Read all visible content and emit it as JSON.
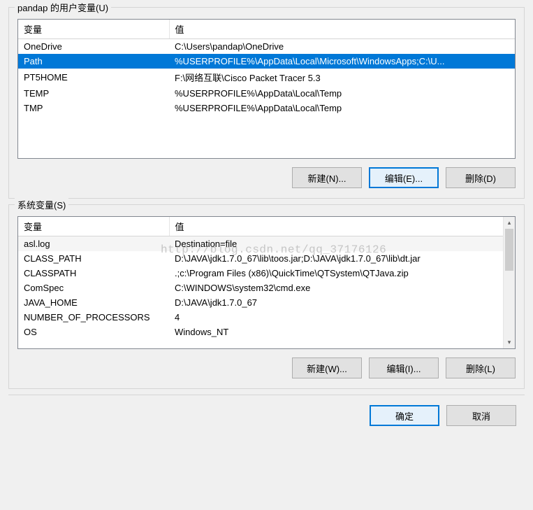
{
  "watermark": "http://blog.csdn.net/qq_37176126",
  "user_section_label": "pandap 的用户变量(U)",
  "system_section_label": "系统变量(S)",
  "col_var": "变量",
  "col_val": "值",
  "user_vars": [
    {
      "name": "OneDrive",
      "value": "C:\\Users\\pandap\\OneDrive"
    },
    {
      "name": "Path",
      "value": "%USERPROFILE%\\AppData\\Local\\Microsoft\\WindowsApps;C:\\U..."
    },
    {
      "name": "PT5HOME",
      "value": "F:\\网络互联\\Cisco Packet Tracer 5.3"
    },
    {
      "name": "TEMP",
      "value": "%USERPROFILE%\\AppData\\Local\\Temp"
    },
    {
      "name": "TMP",
      "value": "%USERPROFILE%\\AppData\\Local\\Temp"
    }
  ],
  "system_vars": [
    {
      "name": "asl.log",
      "value": "Destination=file"
    },
    {
      "name": "CLASS_PATH",
      "value": "D:\\JAVA\\jdk1.7.0_67\\lib\\toos.jar;D:\\JAVA\\jdk1.7.0_67\\lib\\dt.jar"
    },
    {
      "name": "CLASSPATH",
      "value": ".;c:\\Program Files (x86)\\QuickTime\\QTSystem\\QTJava.zip"
    },
    {
      "name": "ComSpec",
      "value": "C:\\WINDOWS\\system32\\cmd.exe"
    },
    {
      "name": "JAVA_HOME",
      "value": "D:\\JAVA\\jdk1.7.0_67"
    },
    {
      "name": "NUMBER_OF_PROCESSORS",
      "value": "4"
    },
    {
      "name": "OS",
      "value": "Windows_NT"
    }
  ],
  "buttons": {
    "user_new": "新建(N)...",
    "user_edit": "编辑(E)...",
    "user_delete": "删除(D)",
    "sys_new": "新建(W)...",
    "sys_edit": "编辑(I)...",
    "sys_delete": "删除(L)",
    "ok": "确定",
    "cancel": "取消"
  }
}
